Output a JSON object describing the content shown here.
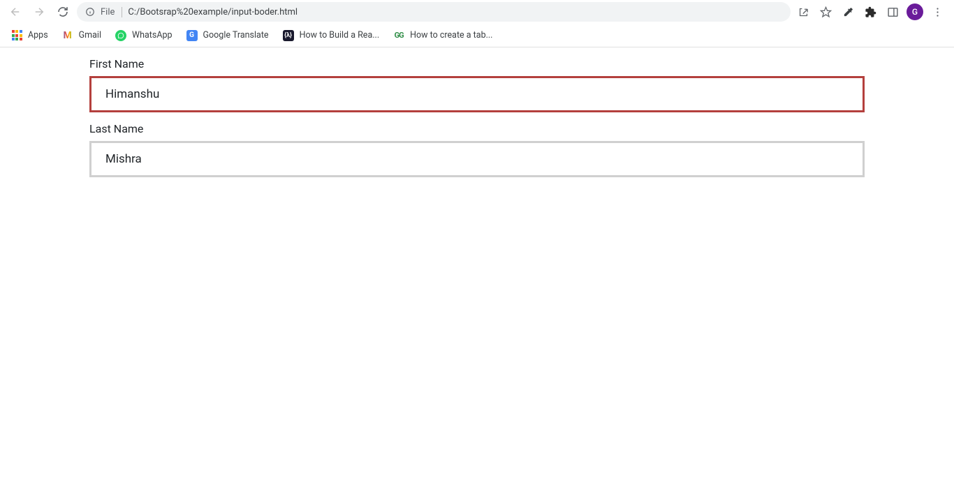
{
  "browser": {
    "url_prefix": "File",
    "url_path": "C:/Bootsrap%20example/input-boder.html",
    "profile_initial": "G"
  },
  "bookmarks": {
    "apps": "Apps",
    "gmail": "Gmail",
    "whatsapp": "WhatsApp",
    "translate": "Google Translate",
    "build": "How to Build a Rea...",
    "gfg": "How to create a tab..."
  },
  "form": {
    "first_name": {
      "label": "First Name",
      "value": "Himanshu"
    },
    "last_name": {
      "label": "Last Name",
      "value": "Mishra"
    }
  }
}
